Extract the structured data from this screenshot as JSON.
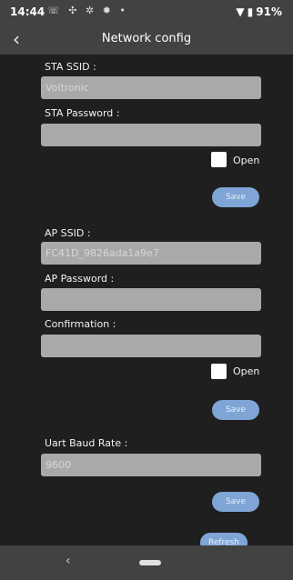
{
  "status": {
    "time": "14:44",
    "notifications": "☏ ✣ ✲ ✹ •",
    "wifi_icon": "▼",
    "battery_icon": "▮",
    "battery": "91%"
  },
  "appbar": {
    "back_icon": "‹",
    "title": "Network config"
  },
  "sta": {
    "ssid_label": "STA SSID :",
    "ssid_value": "Voltronic",
    "password_label": "STA Password :",
    "password_value": "",
    "open_label": "Open",
    "save_label": "Save"
  },
  "ap": {
    "ssid_label": "AP SSID :",
    "ssid_value": "FC41D_9826ada1a9e7",
    "password_label": "AP Password :",
    "password_value": "",
    "confirmation_label": "Confirmation :",
    "confirmation_value": "",
    "open_label": "Open",
    "save_label": "Save"
  },
  "uart": {
    "baud_label": "Uart Baud Rate :",
    "baud_value": "9600",
    "save_label": "Save",
    "refresh_label": "Refresh"
  },
  "navbar": {
    "back_icon": "‹"
  },
  "colors": {
    "background": "#1f1f1f",
    "bar": "#424242",
    "field": "#a9a9a9",
    "button": "#7ea5d6"
  }
}
